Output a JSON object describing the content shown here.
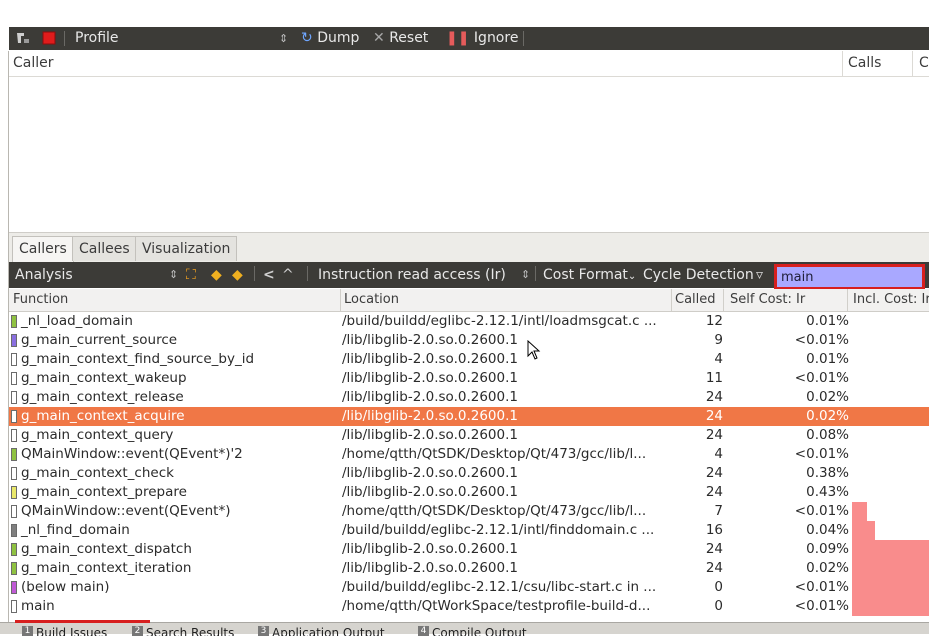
{
  "top_toolbar": {
    "profile_label": "Profile",
    "dump_label": "Dump",
    "reset_label": "Reset",
    "ignore_label": "Ignore"
  },
  "caller_header": {
    "caller_label": "Caller",
    "calls_label": "Calls",
    "extra_label": "C"
  },
  "tabs": [
    {
      "label": "Callers"
    },
    {
      "label": "Callees"
    },
    {
      "label": "Visualization"
    }
  ],
  "analysis_toolbar": {
    "analysis_label": "Analysis",
    "event_label": "Instruction read access (Ir)",
    "cost_format_label": "Cost Format",
    "cycle_detection_label": "Cycle Detection",
    "filter_value": "main"
  },
  "table": {
    "columns": [
      "Function",
      "Location",
      "Called",
      "Self Cost: Ir",
      "Incl. Cost: Ir"
    ],
    "rows": [
      {
        "function": "_nl_load_domain",
        "location": "/build/buildd/eglibc-2.12.1/intl/loadmsgcat.c ...",
        "called": "12",
        "self": "0.01%",
        "incl_fraction": 0.0,
        "swatch": "#8fc241"
      },
      {
        "function": "g_main_current_source",
        "location": "/lib/libglib-2.0.so.0.2600.1",
        "called": "9",
        "self": "<0.01%",
        "incl_fraction": 0.0,
        "swatch": "#8a6fe0"
      },
      {
        "function": "g_main_context_find_source_by_id",
        "location": "/lib/libglib-2.0.so.0.2600.1",
        "called": "4",
        "self": "0.01%",
        "incl_fraction": 0.0,
        "swatch": "#ffffff"
      },
      {
        "function": "g_main_context_wakeup",
        "location": "/lib/libglib-2.0.so.0.2600.1",
        "called": "11",
        "self": "<0.01%",
        "incl_fraction": 0.0,
        "swatch": "#ffffff"
      },
      {
        "function": "g_main_context_release",
        "location": "/lib/libglib-2.0.so.0.2600.1",
        "called": "24",
        "self": "0.02%",
        "incl_fraction": 0.0,
        "swatch": "#ffffff"
      },
      {
        "function": "g_main_context_acquire",
        "location": "/lib/libglib-2.0.so.0.2600.1",
        "called": "24",
        "self": "0.02%",
        "incl_fraction": 0.0,
        "swatch": "#ffffff",
        "selected": true
      },
      {
        "function": "g_main_context_query",
        "location": "/lib/libglib-2.0.so.0.2600.1",
        "called": "24",
        "self": "0.08%",
        "incl_fraction": 0.0,
        "swatch": "#ffffff"
      },
      {
        "function": "QMainWindow::event(QEvent*)'2",
        "location": "/home/qtth/QtSDK/Desktop/Qt/473/gcc/lib/l...",
        "called": "4",
        "self": "<0.01%",
        "incl_fraction": 0.0,
        "swatch": "#8fc241"
      },
      {
        "function": "g_main_context_check",
        "location": "/lib/libglib-2.0.so.0.2600.1",
        "called": "24",
        "self": "0.38%",
        "incl_fraction": 0.0,
        "swatch": "#ffffff"
      },
      {
        "function": "g_main_context_prepare",
        "location": "/lib/libglib-2.0.so.0.2600.1",
        "called": "24",
        "self": "0.43%",
        "incl_fraction": 0.0,
        "swatch": "#e9e86a"
      },
      {
        "function": "QMainWindow::event(QEvent*)",
        "location": "/home/qtth/QtSDK/Desktop/Qt/473/gcc/lib/l...",
        "called": "7",
        "self": "<0.01%",
        "incl_fraction": 0.2,
        "swatch": "#ffffff"
      },
      {
        "function": "_nl_find_domain",
        "location": "/build/buildd/eglibc-2.12.1/intl/finddomain.c ...",
        "called": "16",
        "self": "0.04%",
        "incl_fraction": 0.3,
        "swatch": "#7f7f7f"
      },
      {
        "function": "g_main_context_dispatch",
        "location": "/lib/libglib-2.0.so.0.2600.1",
        "called": "24",
        "self": "0.09%",
        "incl_fraction": 1.0,
        "swatch": "#8fc241"
      },
      {
        "function": "g_main_context_iteration",
        "location": "/lib/libglib-2.0.so.0.2600.1",
        "called": "24",
        "self": "0.02%",
        "incl_fraction": 1.0,
        "swatch": "#8fc241"
      },
      {
        "function": "(below main)",
        "location": "/build/buildd/eglibc-2.12.1/csu/libc-start.c in ...",
        "called": "0",
        "self": "<0.01%",
        "incl_fraction": 1.0,
        "swatch": "#c05ad6"
      },
      {
        "function": "main",
        "location": "/home/qtth/QtWorkSpace/testprofile-build-d...",
        "called": "0",
        "self": "<0.01%",
        "incl_fraction": 1.0,
        "swatch": "#ffffff"
      }
    ]
  },
  "bottom_tabs": [
    {
      "num": "1",
      "label": "Build Issues"
    },
    {
      "num": "2",
      "label": "Search Results"
    },
    {
      "num": "3",
      "label": "Application Output"
    },
    {
      "num": "4",
      "label": "Compile Output"
    }
  ],
  "colors": {
    "toolbar_bg": "#3c3b37",
    "selection": "#f07746",
    "filter_bg": "#a9a8ff",
    "highlight_border": "#d71f1f",
    "incl_bar": "#f98c8c"
  }
}
